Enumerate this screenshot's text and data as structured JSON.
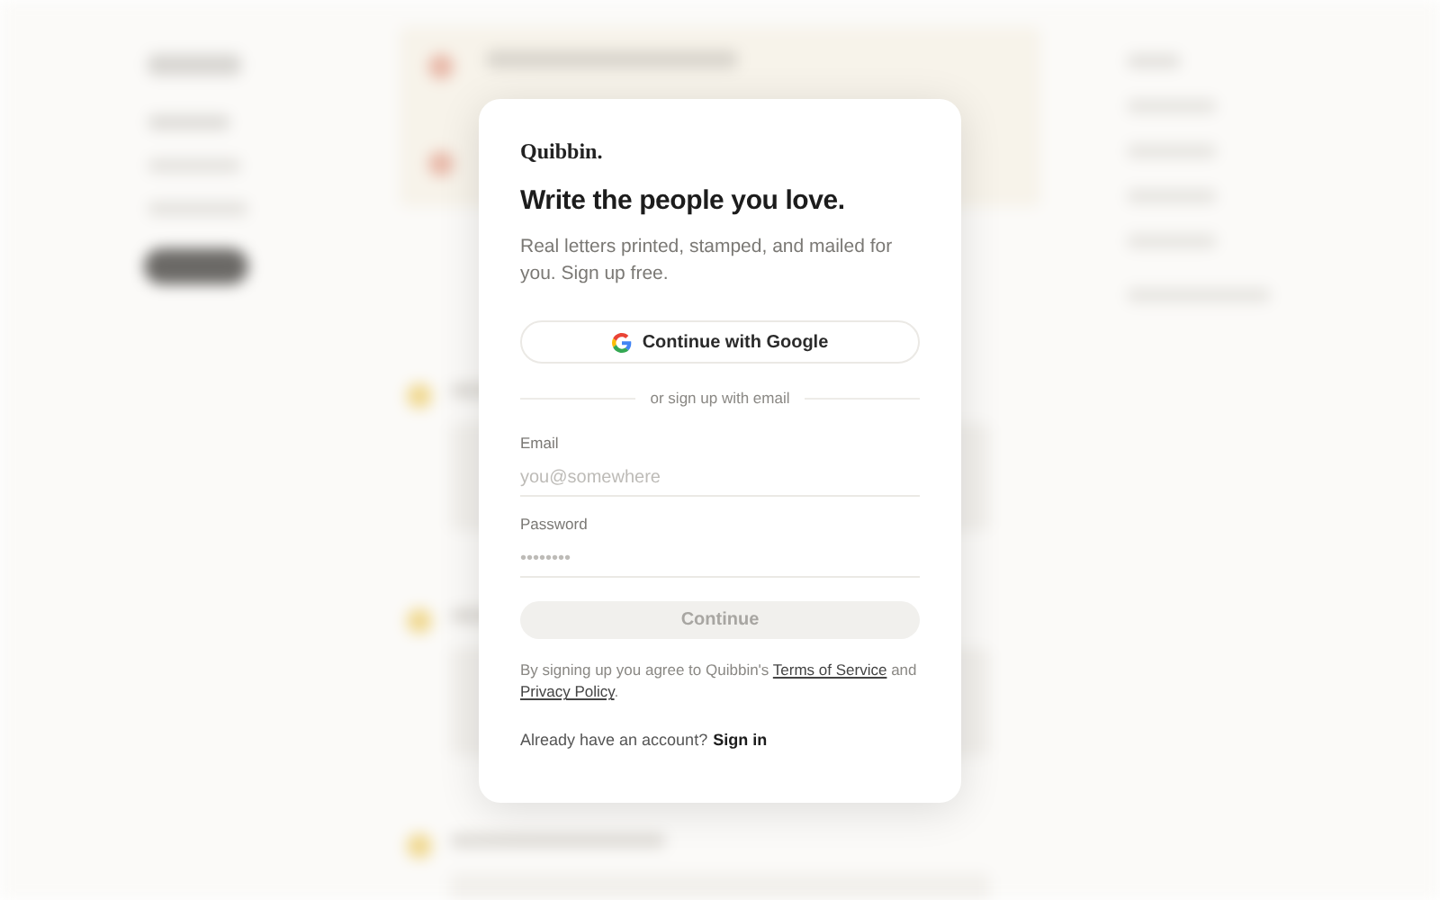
{
  "brand": "Quibbin.",
  "heading": "Write the people you love.",
  "subtitle": "Real letters printed, stamped, and mailed for you. Sign up free.",
  "google_button": "Continue with Google",
  "divider": "or sign up with email",
  "fields": [
    {
      "label": "Email",
      "placeholder": "you@somewhere"
    },
    {
      "label": "Password",
      "placeholder": "••••••••"
    }
  ],
  "submit": {
    "label": "Continue",
    "disabled": true
  },
  "terms": {
    "before": "By signing up you agree to Quibbin's",
    "link1": "Terms of Service",
    "middle": "and",
    "link2": "Privacy Policy",
    "after": "."
  },
  "signin": {
    "prompt": "Already have an account?",
    "link": "Sign in"
  }
}
